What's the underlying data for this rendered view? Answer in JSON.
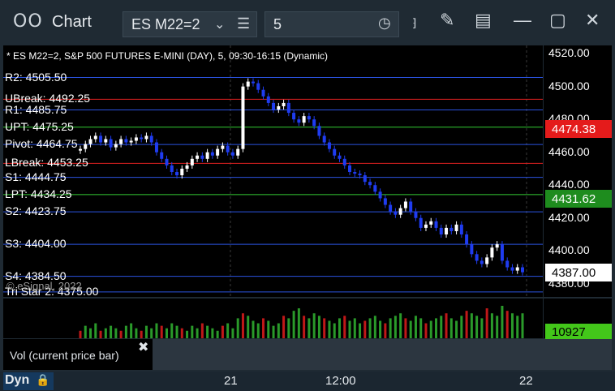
{
  "window": {
    "logo": "OO",
    "title": "Chart",
    "symbol": "ES M22=2",
    "interval": "5"
  },
  "chart": {
    "header": "* ES M22=2, S&P 500 FUTURES E-MINI (DAY), 5, 09:30-16:15 (Dynamic)",
    "watermark": "© eSignal, 2022"
  },
  "levels": [
    {
      "label": "R2: 4505.50",
      "price": 4505.5,
      "color": "#2b53e0"
    },
    {
      "label": "UBreak: 4492.25",
      "price": 4492.25,
      "color": "#e02020"
    },
    {
      "label": "R1: 4485.75",
      "price": 4485.75,
      "color": "#2b53e0"
    },
    {
      "label": "UPT: 4475.25",
      "price": 4475.25,
      "color": "#33cc33"
    },
    {
      "label": "Pivot: 4464.75",
      "price": 4464.75,
      "color": "#2b53e0"
    },
    {
      "label": "LBreak: 4453.25",
      "price": 4453.25,
      "color": "#e02020"
    },
    {
      "label": "S1: 4444.75",
      "price": 4444.75,
      "color": "#2b53e0"
    },
    {
      "label": "LPT: 4434.25",
      "price": 4434.25,
      "color": "#33cc33"
    },
    {
      "label": "S2: 4423.75",
      "price": 4423.75,
      "color": "#2b53e0"
    },
    {
      "label": "S3: 4404.00",
      "price": 4404.0,
      "color": "#2b53e0"
    },
    {
      "label": "S4: 4384.50",
      "price": 4384.5,
      "color": "#2b53e0"
    },
    {
      "label": "Tri Star 2: 4375.00",
      "price": 4375.0,
      "color": "#2b53e0"
    }
  ],
  "price_axis": {
    "ticks": [
      "4520.00",
      "4500.00",
      "4480.00",
      "4460.00",
      "4440.00",
      "4420.00",
      "4400.00",
      "4380.00"
    ],
    "tick_values": [
      4520,
      4500,
      4480,
      4460,
      4440,
      4420,
      4400,
      4380
    ],
    "tags": [
      {
        "text": "4474.38",
        "price": 4474.38,
        "bg": "#e41b1b",
        "fg": "#ffffff"
      },
      {
        "text": "4431.62",
        "price": 4431.62,
        "bg": "#1e8c1e",
        "fg": "#ffffff"
      },
      {
        "text": "4387.00",
        "price": 4387.0,
        "bg": "#ffffff",
        "fg": "#000000"
      }
    ]
  },
  "volume": {
    "study_label": "Vol (current price bar)",
    "last": "10927"
  },
  "time_axis": {
    "labels": [
      "21",
      "12:00",
      "22"
    ],
    "dyn": "Dyn"
  },
  "chart_data": {
    "type": "candlestick",
    "title": "* ES M22=2, S&P 500 FUTURES E-MINI (DAY), 5, 09:30-16:15 (Dynamic)",
    "ylim": [
      4370,
      4525
    ],
    "x_labels": [
      "21",
      "12:00",
      "22"
    ],
    "closes": [
      4462,
      4465,
      4468,
      4470,
      4466,
      4468,
      4463,
      4465,
      4468,
      4466,
      4467,
      4469,
      4468,
      4470,
      4466,
      4460,
      4456,
      4452,
      4448,
      4446,
      4450,
      4452,
      4456,
      4458,
      4456,
      4460,
      4458,
      4462,
      4464,
      4460,
      4458,
      4462,
      4500,
      4503,
      4502,
      4498,
      4494,
      4490,
      4486,
      4488,
      4490,
      4484,
      4480,
      4478,
      4482,
      4480,
      4476,
      4470,
      4466,
      4462,
      4458,
      4456,
      4452,
      4448,
      4447,
      4446,
      4442,
      4440,
      4436,
      4432,
      4428,
      4424,
      4422,
      4426,
      4430,
      4424,
      4420,
      4414,
      4416,
      4418,
      4414,
      4410,
      4414,
      4412,
      4416,
      4410,
      4404,
      4398,
      4394,
      4392,
      4396,
      4402,
      4404,
      4394,
      4390,
      4388,
      4390,
      4387
    ],
    "volume": [
      3,
      5,
      4,
      6,
      3,
      4,
      5,
      4,
      3,
      5,
      6,
      4,
      3,
      5,
      4,
      6,
      5,
      4,
      6,
      5,
      4,
      3,
      5,
      4,
      6,
      5,
      4,
      3,
      5,
      6,
      4,
      8,
      10,
      9,
      7,
      6,
      8,
      7,
      5,
      6,
      9,
      8,
      11,
      12,
      9,
      8,
      10,
      9,
      8,
      7,
      6,
      8,
      9,
      7,
      8,
      6,
      7,
      8,
      9,
      7,
      6,
      8,
      9,
      10,
      8,
      7,
      9,
      8,
      6,
      7,
      8,
      9,
      10,
      8,
      7,
      9,
      11,
      10,
      9,
      8,
      12,
      10,
      9,
      13,
      11,
      10,
      9,
      10
    ]
  }
}
